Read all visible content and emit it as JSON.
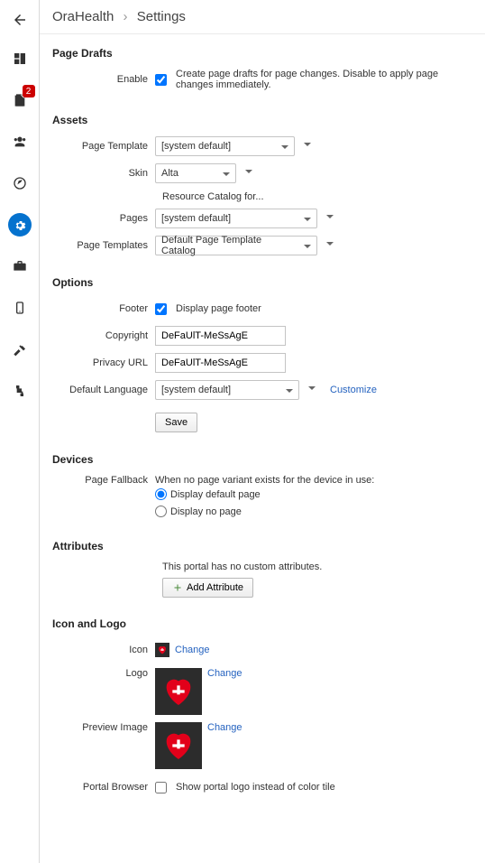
{
  "nav": {
    "badge": "2"
  },
  "breadcrumb": {
    "portal": "OraHealth",
    "sep": "›",
    "page": "Settings"
  },
  "sections": {
    "page_drafts": {
      "title": "Page Drafts",
      "enable_label": "Enable",
      "enable_desc": "Create page drafts for page changes. Disable to apply page changes immediately."
    },
    "assets": {
      "title": "Assets",
      "page_template_label": "Page Template",
      "page_template_value": "[system default]",
      "skin_label": "Skin",
      "skin_value": "Alta",
      "rc_heading": "Resource Catalog for...",
      "pages_label": "Pages",
      "pages_value": "[system default]",
      "page_templates_label": "Page Templates",
      "page_templates_value": "Default Page Template Catalog"
    },
    "options": {
      "title": "Options",
      "footer_label": "Footer",
      "footer_desc": "Display page footer",
      "copyright_label": "Copyright",
      "copyright_value": "DeFaUlT-MeSsAgE",
      "privacy_label": "Privacy URL",
      "privacy_value": "DeFaUlT-MeSsAgE",
      "lang_label": "Default Language",
      "lang_value": "[system default]",
      "customize": "Customize",
      "save": "Save"
    },
    "devices": {
      "title": "Devices",
      "pf_label": "Page Fallback",
      "pf_desc": "When no page variant exists for the device in use:",
      "pf_opt1": "Display default page",
      "pf_opt2": "Display no page"
    },
    "attributes": {
      "title": "Attributes",
      "empty": "This portal has no custom attributes.",
      "add": "Add Attribute"
    },
    "icon_logo": {
      "title": "Icon and Logo",
      "icon_label": "Icon",
      "logo_label": "Logo",
      "preview_label": "Preview Image",
      "change": "Change",
      "pb_label": "Portal Browser",
      "pb_desc": "Show portal logo instead of color tile"
    }
  }
}
